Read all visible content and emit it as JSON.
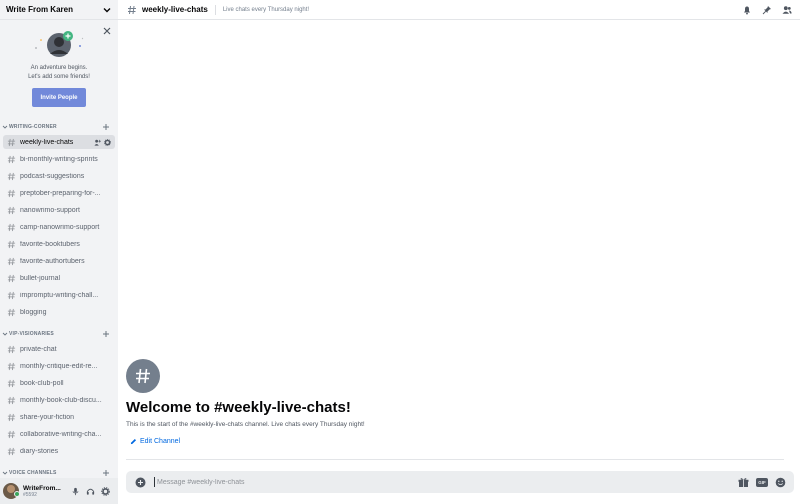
{
  "server": {
    "name": "Write From Karen"
  },
  "invite": {
    "line1": "An adventure begins.",
    "line2": "Let's add some friends!",
    "button_label": "Invite People"
  },
  "categories": [
    {
      "label": "WRITING-CORNER"
    },
    {
      "label": "VIP-VISIONARIES"
    },
    {
      "label": "VOICE CHANNELS"
    }
  ],
  "writing_channels": [
    "weekly-live-chats",
    "bi-monthly-writing-sprints",
    "podcast-suggestions",
    "preptober-preparing-for-...",
    "nanowrimo-support",
    "camp-nanowrimo-support",
    "favorite-booktubers",
    "favorite-authortubers",
    "bullet-journal",
    "impromptu-writing-chall...",
    "blogging"
  ],
  "vip_channels": [
    "private-chat",
    "monthly-critique-edit-re...",
    "book-club-poll",
    "monthly-book-club-discu...",
    "share-your-fiction",
    "collaborative-writing-cha...",
    "diary-stories"
  ],
  "user": {
    "name": "WriteFrom...",
    "discriminator": "#5592"
  },
  "topbar": {
    "channel": "weekly-live-chats",
    "topic": "Live chats every Thursday night!"
  },
  "welcome": {
    "title": "Welcome to #weekly-live-chats!",
    "subtitle": "This is the start of the #weekly-live-chats channel. Live chats every Thursday night!",
    "edit_label": "Edit Channel"
  },
  "composer": {
    "placeholder": "Message #weekly-live-chats",
    "gif_label": "GIF"
  },
  "colors": {
    "accent": "#7289da",
    "link": "#0068e0",
    "online": "#3ba55c",
    "sidebar_bg": "#f2f3f5"
  }
}
